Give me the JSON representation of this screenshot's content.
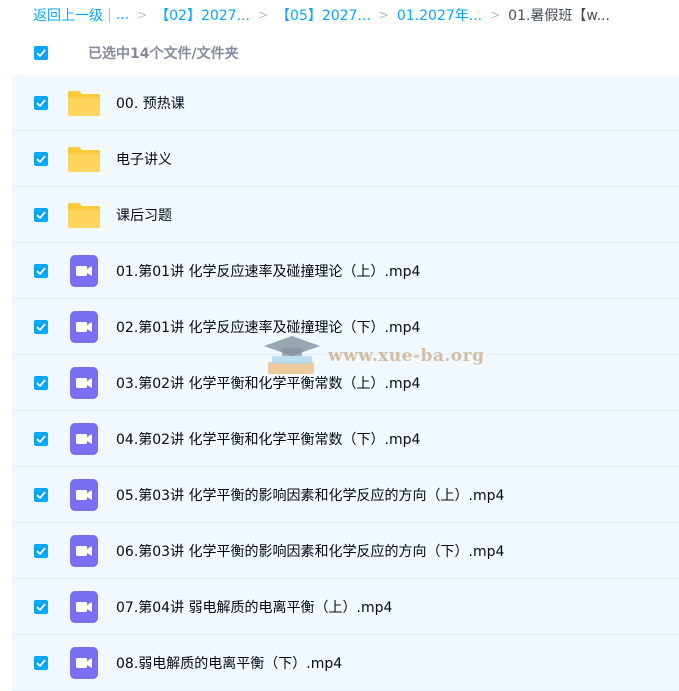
{
  "breadcrumb": {
    "back_label": "返回上一级",
    "divider": "|",
    "ellipsis": "...",
    "items": [
      {
        "label": "【02】2027..."
      },
      {
        "label": "【05】2027..."
      },
      {
        "label": "01.2027年..."
      }
    ],
    "current": "01.暑假班【w..."
  },
  "selection": {
    "summary": "已选中14个文件/文件夹",
    "all_checked": true
  },
  "files": [
    {
      "name": "00. 预热课",
      "type": "folder",
      "checked": true
    },
    {
      "name": "电子讲义",
      "type": "folder",
      "checked": true
    },
    {
      "name": "课后习题",
      "type": "folder",
      "checked": true
    },
    {
      "name": "01.第01讲 化学反应速率及碰撞理论（上）.mp4",
      "type": "video",
      "checked": true
    },
    {
      "name": "02.第01讲 化学反应速率及碰撞理论（下）.mp4",
      "type": "video",
      "checked": true
    },
    {
      "name": "03.第02讲 化学平衡和化学平衡常数（上）.mp4",
      "type": "video",
      "checked": true
    },
    {
      "name": "04.第02讲 化学平衡和化学平衡常数（下）.mp4",
      "type": "video",
      "checked": true
    },
    {
      "name": "05.第03讲 化学平衡的影响因素和化学反应的方向（上）.mp4",
      "type": "video",
      "checked": true
    },
    {
      "name": "06.第03讲 化学平衡的影响因素和化学反应的方向（下）.mp4",
      "type": "video",
      "checked": true
    },
    {
      "name": "07.第04讲 弱电解质的电离平衡（上）.mp4",
      "type": "video",
      "checked": true
    },
    {
      "name": "08.弱电解质的电离平衡（下）.mp4",
      "type": "video",
      "checked": true
    }
  ],
  "watermark": {
    "text": "www.xue-ba.org"
  },
  "colors": {
    "accent": "#06a7ff",
    "folder": "#ffc83d",
    "video": "#7a6ff0",
    "row_selected_bg": "#f1f9ff"
  }
}
